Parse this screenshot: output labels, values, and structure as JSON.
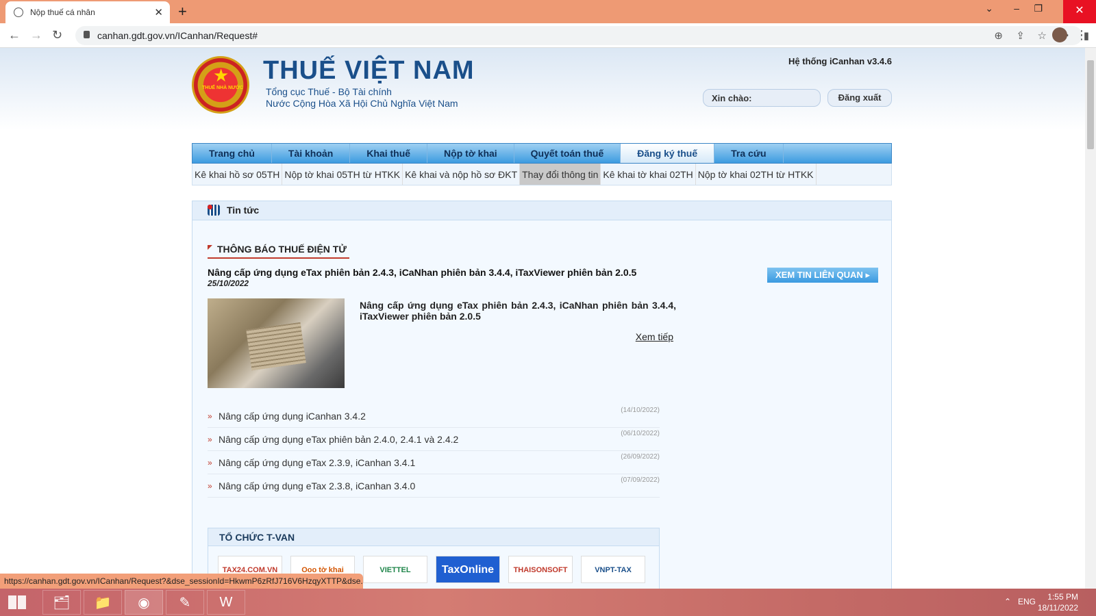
{
  "browser": {
    "tab_title": "Nộp thuế cá nhân",
    "url": "canhan.gdt.gov.vn/ICanhan/Request#",
    "status_url": "https://canhan.gdt.gov.vn/ICanhan/Request?&dse_sessionId=HkwmP6zRfJ716V6HzqyXTTP&dse..."
  },
  "header": {
    "seal_text": "THUẾ NHÀ NƯỚC",
    "brand": "THUẾ VIỆT NAM",
    "subtitle1": "Tổng cục Thuế - Bộ Tài chính",
    "subtitle2": "Nước Cộng Hòa Xã Hội Chủ Nghĩa Việt Nam",
    "system_version": "Hệ thống iCanhan v3.4.6",
    "greeting": "Xin chào:",
    "logout": "Đăng xuất"
  },
  "menu": [
    "Trang chủ",
    "Tài khoản",
    "Khai thuế",
    "Nộp tờ khai",
    "Quyết toán thuế",
    "Đăng ký thuế",
    "Tra cứu"
  ],
  "menu_active": "Đăng ký thuế",
  "submenu": [
    "Kê khai hồ sơ 05TH",
    "Nộp tờ khai 05TH từ HTKK",
    "Kê khai và nộp hồ sơ ĐKT",
    "Thay đổi thông tin",
    "Kê khai tờ khai 02TH",
    "Nộp tờ khai 02TH từ HTKK"
  ],
  "submenu_active": "Thay đổi thông tin",
  "news": {
    "panel_title": "Tin tức",
    "section_title": "THÔNG BÁO THUẾ ĐIỆN TỬ",
    "headline": "Nâng cấp ứng dụng eTax phiên bản 2.4.3, iCaNhan phiên bản 3.4.4, iTaxViewer phiên bản 2.0.5",
    "date": "25/10/2022",
    "related_button": "XEM TIN LIÊN QUAN",
    "lead": "Nâng cấp ứng dụng eTax phiên bản 2.4.3, iCaNhan phiên bản 3.4.4, iTaxViewer phiên bản 2.0.5",
    "read_more": "Xem tiếp",
    "items": [
      {
        "title": "Nâng cấp ứng dụng iCanhan 3.4.2",
        "date": "(14/10/2022)"
      },
      {
        "title": "Nâng cấp ứng dụng eTax phiên bản 2.4.0, 2.4.1 và 2.4.2",
        "date": "(06/10/2022)"
      },
      {
        "title": "Nâng cấp ứng dụng eTax 2.3.9, iCanhan 3.4.1",
        "date": "(26/09/2022)"
      },
      {
        "title": "Nâng cấp ứng dụng eTax 2.3.8, iCanhan 3.4.0",
        "date": "(07/09/2022)"
      }
    ]
  },
  "tvan": {
    "title": "TỔ CHỨC T-VAN",
    "logos": [
      "TAX24.COM.VN",
      "Ooo tờ khai",
      "VIETTEL",
      "TaxOnline",
      "THAISONSOFT",
      "VNPT-TAX"
    ]
  },
  "taskbar": {
    "lang": "ENG",
    "time": "1:55 PM",
    "date": "18/11/2022"
  }
}
